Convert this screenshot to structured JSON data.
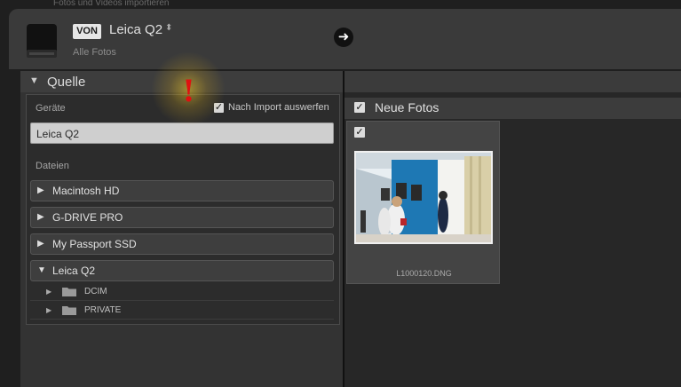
{
  "window": {
    "title": "Fotos und Videos importieren"
  },
  "header": {
    "from_badge": "VON",
    "source_name": "Leica Q2",
    "source_arrows": "⬍",
    "source_subtitle": "Alle Fotos",
    "go_icon": "arrow-right-icon"
  },
  "source_panel": {
    "title": "Quelle",
    "devices_label": "Geräte",
    "eject_label": "Nach Import auswerfen",
    "eject_checked": true,
    "device_value": "Leica Q2",
    "files_label": "Dateien",
    "volumes": [
      {
        "label": "Macintosh HD",
        "expanded": false
      },
      {
        "label": "G-DRIVE PRO",
        "expanded": false
      },
      {
        "label": "My Passport SSD",
        "expanded": false
      },
      {
        "label": "Leica Q2",
        "expanded": true
      }
    ],
    "folders": [
      {
        "label": "DCIM"
      },
      {
        "label": "PRIVATE"
      }
    ]
  },
  "warning": {
    "symbol": "!",
    "color": "#e01010"
  },
  "photos_panel": {
    "group_title": "Neue Fotos",
    "group_checked": true,
    "photos": [
      {
        "filename": "L1000120.DNG",
        "checked": true
      }
    ]
  }
}
